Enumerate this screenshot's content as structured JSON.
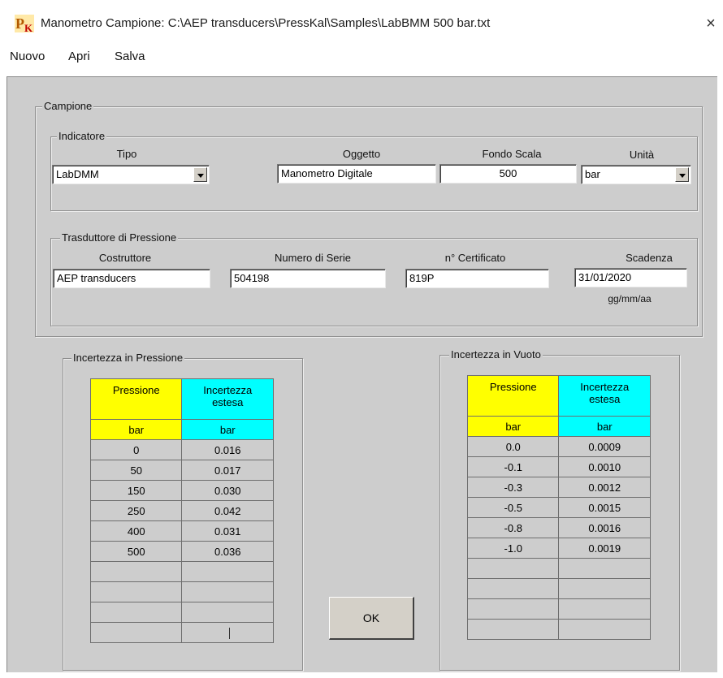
{
  "window": {
    "title": "Manometro Campione: C:\\AEP transducers\\PressKal\\Samples\\LabBMM 500 bar.txt",
    "close_glyph": "×",
    "icon": "pk-app-icon",
    "icon_text": "PK"
  },
  "menu": {
    "items": [
      {
        "label": "Nuovo"
      },
      {
        "label": "Apri"
      },
      {
        "label": "Salva"
      }
    ]
  },
  "campione": {
    "title": "Campione",
    "indicatore": {
      "title": "Indicatore",
      "labels": {
        "tipo": "Tipo",
        "oggetto": "Oggetto",
        "fondo_scala": "Fondo Scala",
        "unita": "Unità"
      },
      "values": {
        "tipo": "LabDMM",
        "oggetto": "Manometro Digitale",
        "fondo_scala": "500",
        "unita": "bar"
      }
    },
    "trasduttore": {
      "title": "Trasduttore di Pressione",
      "labels": {
        "costruttore": "Costruttore",
        "numero_serie": "Numero di Serie",
        "certificato": "n° Certificato",
        "scadenza": "Scadenza",
        "date_format": "gg/mm/aa"
      },
      "values": {
        "costruttore": "AEP transducers",
        "numero_serie": "504198",
        "certificato": "819P",
        "scadenza": "31/01/2020"
      }
    }
  },
  "incertezza_pressione": {
    "title": "Incertezza in Pressione",
    "headers": [
      "Pressione",
      "Incertezza\nestesa"
    ],
    "units": [
      "bar",
      "bar"
    ],
    "rows": [
      [
        "0",
        "0.016"
      ],
      [
        "50",
        "0.017"
      ],
      [
        "150",
        "0.030"
      ],
      [
        "250",
        "0.042"
      ],
      [
        "400",
        "0.031"
      ],
      [
        "500",
        "0.036"
      ],
      [
        "",
        ""
      ],
      [
        "",
        ""
      ],
      [
        "",
        ""
      ],
      [
        "",
        ""
      ]
    ]
  },
  "incertezza_vuoto": {
    "title": "Incertezza in Vuoto",
    "headers": [
      "Pressione",
      "Incertezza\nestesa"
    ],
    "units": [
      "bar",
      "bar"
    ],
    "rows": [
      [
        "0.0",
        "0.0009"
      ],
      [
        "-0.1",
        "0.0010"
      ],
      [
        "-0.3",
        "0.0012"
      ],
      [
        "-0.5",
        "0.0015"
      ],
      [
        "-0.8",
        "0.0016"
      ],
      [
        "-1.0",
        "0.0019"
      ],
      [
        "",
        ""
      ],
      [
        "",
        ""
      ],
      [
        "",
        ""
      ],
      [
        "",
        ""
      ]
    ]
  },
  "buttons": {
    "ok": "OK"
  },
  "colors": {
    "header_yellow": "#ffff00",
    "header_cyan": "#00ffff",
    "client_bg": "#cdcdcd"
  }
}
